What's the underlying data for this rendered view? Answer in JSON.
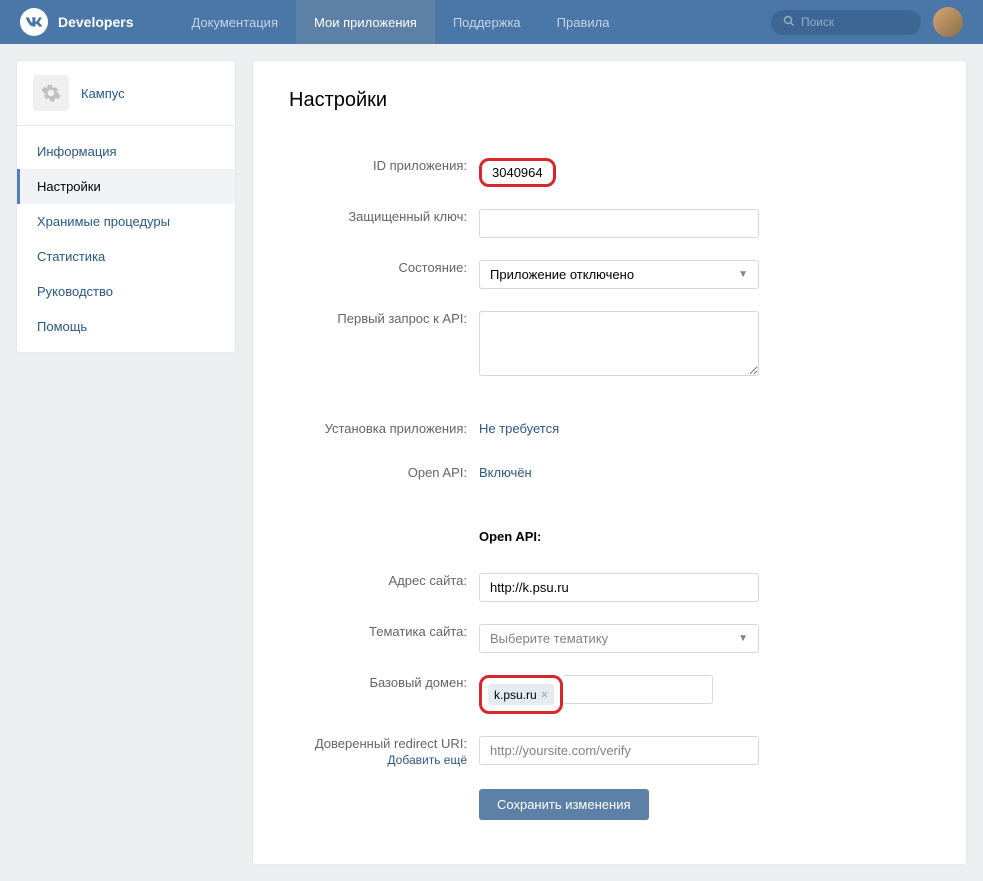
{
  "header": {
    "brand": "Developers",
    "nav": [
      {
        "label": "Документация"
      },
      {
        "label": "Мои приложения"
      },
      {
        "label": "Поддержка"
      },
      {
        "label": "Правила"
      }
    ],
    "search_placeholder": "Поиск"
  },
  "sidebar": {
    "app_name": "Кампус",
    "items": [
      {
        "label": "Информация"
      },
      {
        "label": "Настройки"
      },
      {
        "label": "Хранимые процедуры"
      },
      {
        "label": "Статистика"
      },
      {
        "label": "Руководство"
      },
      {
        "label": "Помощь"
      }
    ]
  },
  "main": {
    "title": "Настройки",
    "fields": {
      "app_id_label": "ID приложения:",
      "app_id_value": "3040964",
      "secret_key_label": "Защищенный ключ:",
      "secret_key_value": "",
      "status_label": "Состояние:",
      "status_value": "Приложение отключено",
      "first_request_label": "Первый запрос к API:",
      "first_request_value": "",
      "install_label": "Установка приложения:",
      "install_value": "Не требуется",
      "openapi_label": "Open API:",
      "openapi_value": "Включён",
      "openapi_section": "Open API:",
      "site_url_label": "Адрес сайта:",
      "site_url_value": "http://k.psu.ru",
      "site_theme_label": "Тематика сайта:",
      "site_theme_placeholder": "Выберите тематику",
      "base_domain_label": "Базовый домен:",
      "base_domain_value": "k.psu.ru",
      "redirect_label": "Доверенный redirect URI:",
      "redirect_placeholder": "http://yoursite.com/verify",
      "redirect_add": "Добавить ещё",
      "submit": "Сохранить изменения"
    }
  }
}
